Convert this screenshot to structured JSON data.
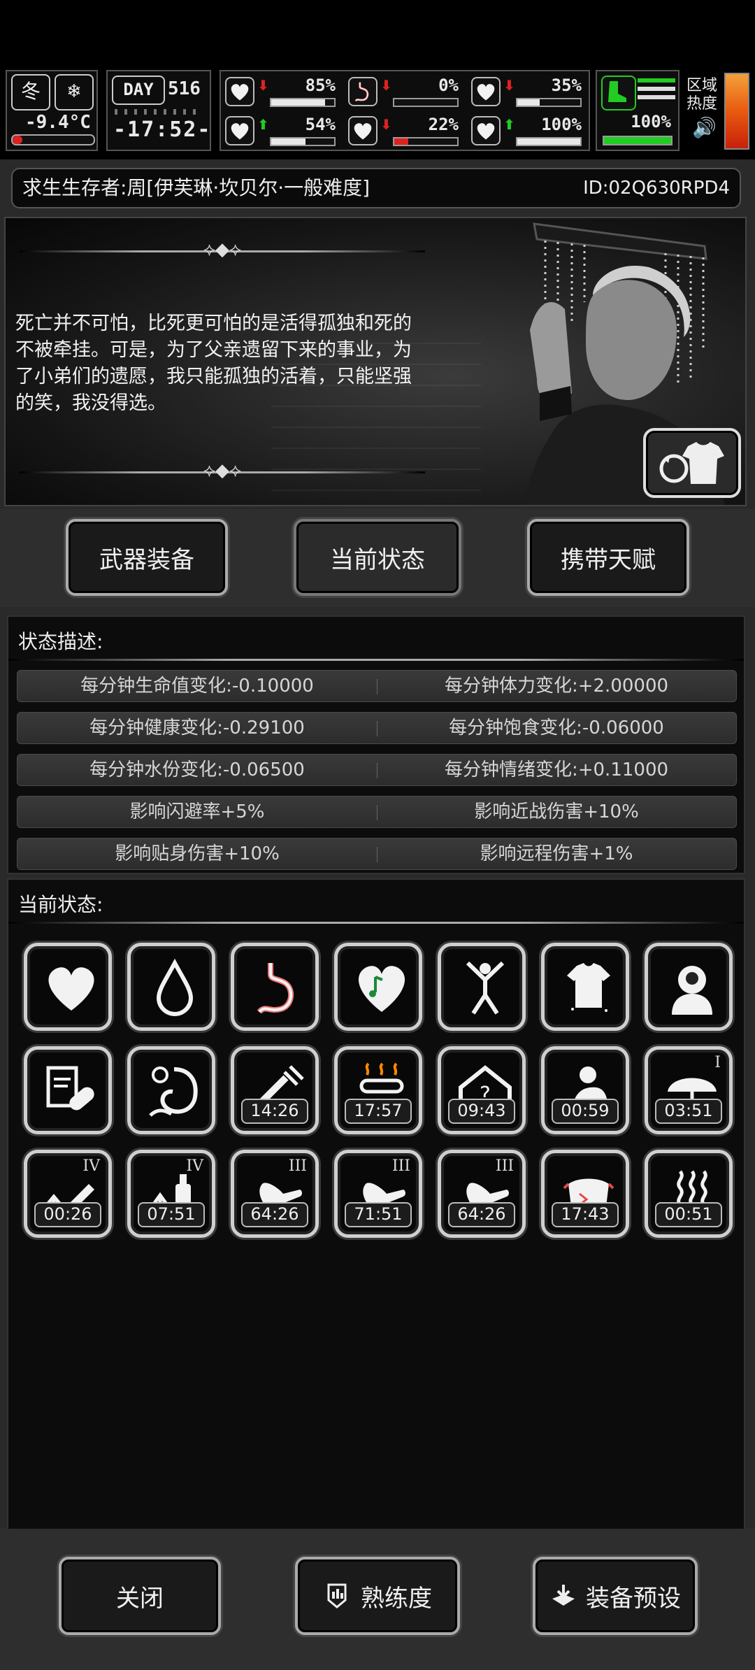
{
  "hud": {
    "season": "冬",
    "temperature": "-9.4°C",
    "day_label": "DAY",
    "day_number": "516",
    "clock": "-17:52-",
    "region_heat_label": "区域\n热度",
    "stats": [
      {
        "name": "health",
        "icon": "medkit-icon",
        "arrow": "down",
        "value": "85%",
        "fill": 0.85,
        "color": "#e8e8e8"
      },
      {
        "name": "satiety",
        "icon": "stomach-icon",
        "arrow": "down",
        "value": "0%",
        "fill": 0.0,
        "color": "#e8e8e8"
      },
      {
        "name": "bladder",
        "icon": "toilet-icon",
        "arrow": "down",
        "value": "35%",
        "fill": 0.35,
        "color": "#e8e8e8"
      },
      {
        "name": "mind",
        "icon": "brain-icon",
        "arrow": "up",
        "value": "54%",
        "fill": 0.54,
        "color": "#e8e8e8"
      },
      {
        "name": "water",
        "icon": "blood-drop-icon",
        "arrow": "down",
        "value": "22%",
        "fill": 0.22,
        "color": "#d22"
      },
      {
        "name": "mood",
        "icon": "heart-icon",
        "arrow": "up",
        "value": "100%",
        "fill": 1.0,
        "color": "#e8e8e8"
      }
    ],
    "stamina": {
      "value": "100%",
      "fill": 1.0,
      "color": "#2c2"
    }
  },
  "survivor": {
    "name": "求生生存者:周[伊芙琳·坎贝尔·一般难度]",
    "id": "ID:02Q630RPD4"
  },
  "quote": "死亡并不可怕，比死更可怕的是活得孤独和死的不被牵挂。可是，为了父亲遗留下来的事业，为了小弟们的遗愿，我只能孤独的活着，只能坚强的笑，我没得选。",
  "tabs": {
    "weapons": "武器装备",
    "status": "当前状态",
    "talents": "携带天赋"
  },
  "status_desc_title": "状态描述:",
  "effects": [
    [
      "每分钟生命值变化:-0.10000",
      "每分钟体力变化:+2.00000"
    ],
    [
      "每分钟健康变化:-0.29100",
      "每分钟饱食变化:-0.06000"
    ],
    [
      "每分钟水份变化:-0.06500",
      "每分钟情绪变化:+0.11000"
    ],
    [
      "影响闪避率+5%",
      "影响近战伤害+10%"
    ],
    [
      "影响贴身伤害+10%",
      "影响远程伤害+1%"
    ]
  ],
  "current_status_title": "当前状态:",
  "status_icons": [
    {
      "icon": "heart-icon",
      "timer": "",
      "tier": ""
    },
    {
      "icon": "water-drop-icon",
      "timer": "",
      "tier": ""
    },
    {
      "icon": "stomach-icon",
      "timer": "",
      "tier": ""
    },
    {
      "icon": "music-heart-icon",
      "timer": "",
      "tier": ""
    },
    {
      "icon": "stretching-person-icon",
      "timer": "",
      "tier": ""
    },
    {
      "icon": "clean-shirt-icon",
      "timer": "",
      "tier": ""
    },
    {
      "icon": "head-profile-icon",
      "timer": "",
      "tier": ""
    },
    {
      "icon": "medical-record-pill-icon",
      "timer": "",
      "tier": ""
    },
    {
      "icon": "digestion-icon",
      "timer": "",
      "tier": ""
    },
    {
      "icon": "syringe-icon",
      "timer": "14:26",
      "tier": ""
    },
    {
      "icon": "hot-thermometer-icon",
      "timer": "17:57",
      "tier": ""
    },
    {
      "icon": "shelter-question-icon",
      "timer": "09:43",
      "tier": ""
    },
    {
      "icon": "tired-person-icon",
      "timer": "00:59",
      "tier": ""
    },
    {
      "icon": "umbrella-icon",
      "timer": "03:51",
      "tier": "I"
    },
    {
      "icon": "pencil-up-icon",
      "timer": "00:26",
      "tier": "IV"
    },
    {
      "icon": "bottle-up-icon",
      "timer": "07:51",
      "tier": "IV"
    },
    {
      "icon": "hand-icon",
      "timer": "64:26",
      "tier": "III"
    },
    {
      "icon": "hand-icon",
      "timer": "71:51",
      "tier": "III"
    },
    {
      "icon": "hand-icon",
      "timer": "64:26",
      "tier": "III"
    },
    {
      "icon": "mask-icon",
      "timer": "17:43",
      "tier": ""
    },
    {
      "icon": "steam-icon",
      "timer": "00:51",
      "tier": ""
    }
  ],
  "bottom": {
    "close": "关闭",
    "proficiency": "熟练度",
    "preset": "装备预设"
  }
}
